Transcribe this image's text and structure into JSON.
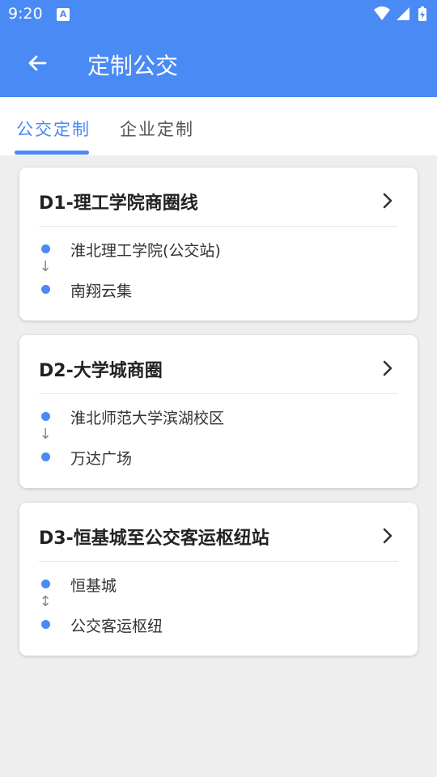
{
  "status_bar": {
    "time": "9:20",
    "notification_icon": "A"
  },
  "app_bar": {
    "title": "定制公交"
  },
  "tabs": [
    {
      "label": "公交定制",
      "active": true
    },
    {
      "label": "企业定制",
      "active": false
    }
  ],
  "routes": [
    {
      "name": "D1-理工学院商圈线",
      "from": "淮北理工学院(公交站)",
      "to": "南翔云集",
      "direction_icon": "↓"
    },
    {
      "name": "D2-大学城商圈",
      "from": "淮北师范大学滨湖校区",
      "to": "万达广场",
      "direction_icon": "↓"
    },
    {
      "name": "D3-恒基城至公交客运枢纽站",
      "from": "恒基城",
      "to": "公交客运枢纽",
      "direction_icon": "↕"
    }
  ],
  "colors": {
    "primary": "#4a8af4",
    "background": "#eeeeee"
  }
}
